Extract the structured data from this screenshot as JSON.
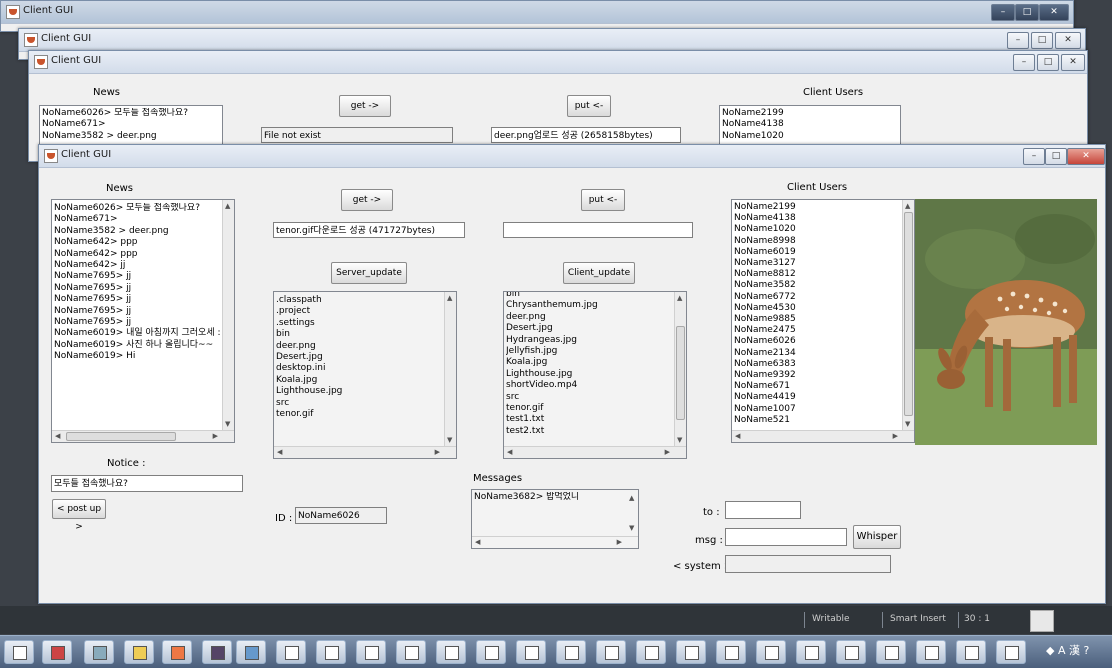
{
  "windows": {
    "back": {
      "title": "Client GUI"
    },
    "middle": {
      "title": "Client GUI"
    },
    "third": {
      "title": "Client GUI",
      "news_label": "News",
      "get_label": "get ->",
      "put_label": "put <-",
      "client_users_label": "Client Users",
      "news_items": [
        "NoName6026> 모두들 접속했나요?",
        "NoName671>",
        "NoName3582 > deer.png"
      ],
      "get_status": "File not exist",
      "put_status": "deer.png업로드 성공 (2658158bytes)",
      "users": [
        "NoName2199",
        "NoName4138",
        "NoName1020"
      ]
    },
    "front": {
      "title": "Client GUI",
      "news_label": "News",
      "news_items": [
        "NoName6026> 모두들 접속했나요?",
        "NoName671>",
        "NoName3582 > deer.png",
        "NoName642> ppp",
        "NoName642> ppp",
        "NoName642> jj",
        "NoName7695> jj",
        "NoName7695> jj",
        "NoName7695> jj",
        "NoName7695> jj",
        "NoName7695> jj",
        "NoName6019> 내일 아침까지 그러오세 :",
        "NoName6019> 사진 하나 올립니다~~",
        "NoName6019> Hi"
      ],
      "get_label": "get ->",
      "put_label": "put <-",
      "get_status": "tenor.gif다운로드 성공 (471727bytes)",
      "put_status": "",
      "server_update_label": "Server_update",
      "client_update_label": "Client_update",
      "server_files": [
        ".classpath",
        ".project",
        ".settings",
        "bin",
        "deer.png",
        "Desert.jpg",
        "desktop.ini",
        "Koala.jpg",
        "Lighthouse.jpg",
        "src",
        "tenor.gif"
      ],
      "client_files": [
        "bin",
        "Chrysanthemum.jpg",
        "deer.png",
        "Desert.jpg",
        "Hydrangeas.jpg",
        "Jellyfish.jpg",
        "Koala.jpg",
        "Lighthouse.jpg",
        "shortVideo.mp4",
        "src",
        "tenor.gif",
        "test1.txt",
        "test2.txt"
      ],
      "client_users_label": "Client Users",
      "users": [
        "NoName2199",
        "NoName4138",
        "NoName1020",
        "NoName8998",
        "NoName6019",
        "NoName3127",
        "NoName8812",
        "NoName3582",
        "NoName6772",
        "NoName4530",
        "NoName9885",
        "NoName2475",
        "NoName6026",
        "NoName2134",
        "NoName6383",
        "NoName9392",
        "NoName671",
        "NoName4419",
        "NoName1007",
        "NoName521"
      ],
      "notice_label": "Notice :",
      "notice_value": "모두들 접속했나요?",
      "post_up_label": "< post up >",
      "id_label": "ID :",
      "id_value": "NoName6026",
      "messages_label": "Messages",
      "messages": [
        "NoName3682> 밥먹었니"
      ],
      "to_label": "to :",
      "msg_label": "msg :",
      "to_value": "",
      "msg_value": "",
      "whisper_label": "Whisper",
      "system_label": "< system >",
      "system_value": ""
    }
  },
  "ide_status": {
    "writable": "Writable",
    "insert_mode": "Smart Insert",
    "position": "30 : 1"
  },
  "taskbar": {
    "java_buttons": 19
  }
}
